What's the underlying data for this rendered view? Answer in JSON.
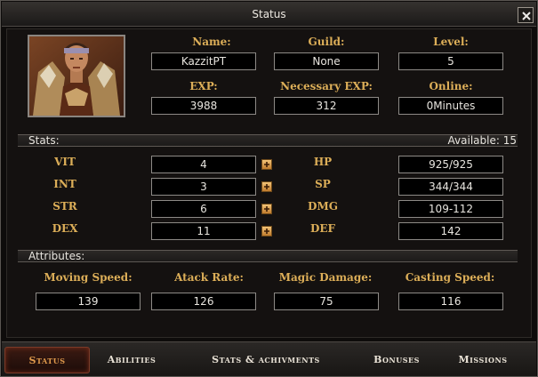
{
  "window": {
    "title": "Status"
  },
  "character": {
    "name_label": "Name:",
    "name": "KazzitPT",
    "guild_label": "Guild:",
    "guild": "None",
    "level_label": "Level:",
    "level": "5",
    "exp_label": "EXP:",
    "exp": "3988",
    "necessary_exp_label": "Necessary EXP:",
    "necessary_exp": "312",
    "online_label": "Online:",
    "online": "0Minutes"
  },
  "stats": {
    "header": "Stats:",
    "available": "Available: 15",
    "vit_label": "VIT",
    "vit": "4",
    "int_label": "INT",
    "int": "3",
    "str_label": "STR",
    "str": "6",
    "dex_label": "DEX",
    "dex": "11",
    "hp_label": "HP",
    "hp": "925/925",
    "sp_label": "SP",
    "sp": "344/344",
    "dmg_label": "DMG",
    "dmg": "109-112",
    "def_label": "DEF",
    "def": "142"
  },
  "attributes": {
    "header": "Attributes:",
    "moving_speed_label": "Moving Speed:",
    "moving_speed": "139",
    "attack_rate_label": "Atack Rate:",
    "attack_rate": "126",
    "magic_damage_label": "Magic Damage:",
    "magic_damage": "75",
    "casting_speed_label": "Casting Speed:",
    "casting_speed": "116"
  },
  "tabs": [
    {
      "label": "Status",
      "active": true
    },
    {
      "label": "Abilities",
      "active": false
    },
    {
      "label": "Stats & achivments",
      "active": false
    },
    {
      "label": "Bonuses",
      "active": false
    },
    {
      "label": "Missions",
      "active": false
    }
  ],
  "icons": {
    "close": "close-icon",
    "plus": "plus-icon",
    "portrait": "character-portrait"
  },
  "colors": {
    "label_gold": "#dcae58",
    "value_text": "#e8e5df",
    "active_tab": "#e09a4c",
    "plus_button": "#e8a24c"
  }
}
